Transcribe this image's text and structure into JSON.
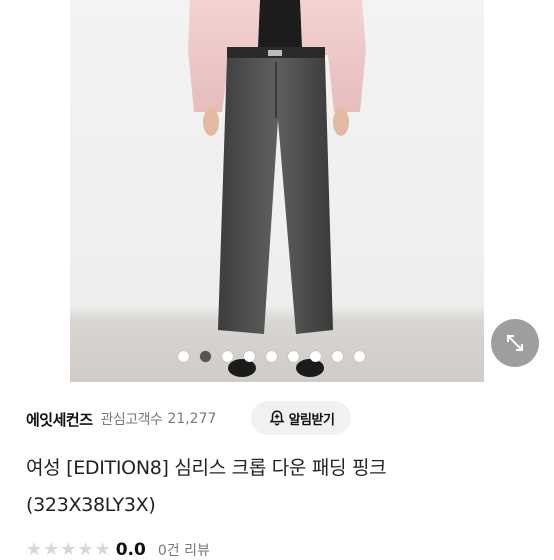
{
  "carousel": {
    "image_alt": "product-photo",
    "slide_count": 9,
    "active_index": 1
  },
  "seller": {
    "name": "에잇세컨즈",
    "favorites_label": "관심고객수",
    "favorites_count": "21,277",
    "alarm_button_label": "알림받기"
  },
  "product": {
    "title_line1": "여성 [EDITION8] 심리스 크롭 다운 패딩 핑크",
    "title_line2": "(323X38LY3X)"
  },
  "rating": {
    "value": "0.0",
    "stars_filled": 0,
    "stars_total": 5,
    "review_count": "0건 리뷰"
  },
  "colors": {
    "active_dot": "#555555",
    "jacket": "#efc9c9",
    "jeans": "#4a4a4a"
  }
}
